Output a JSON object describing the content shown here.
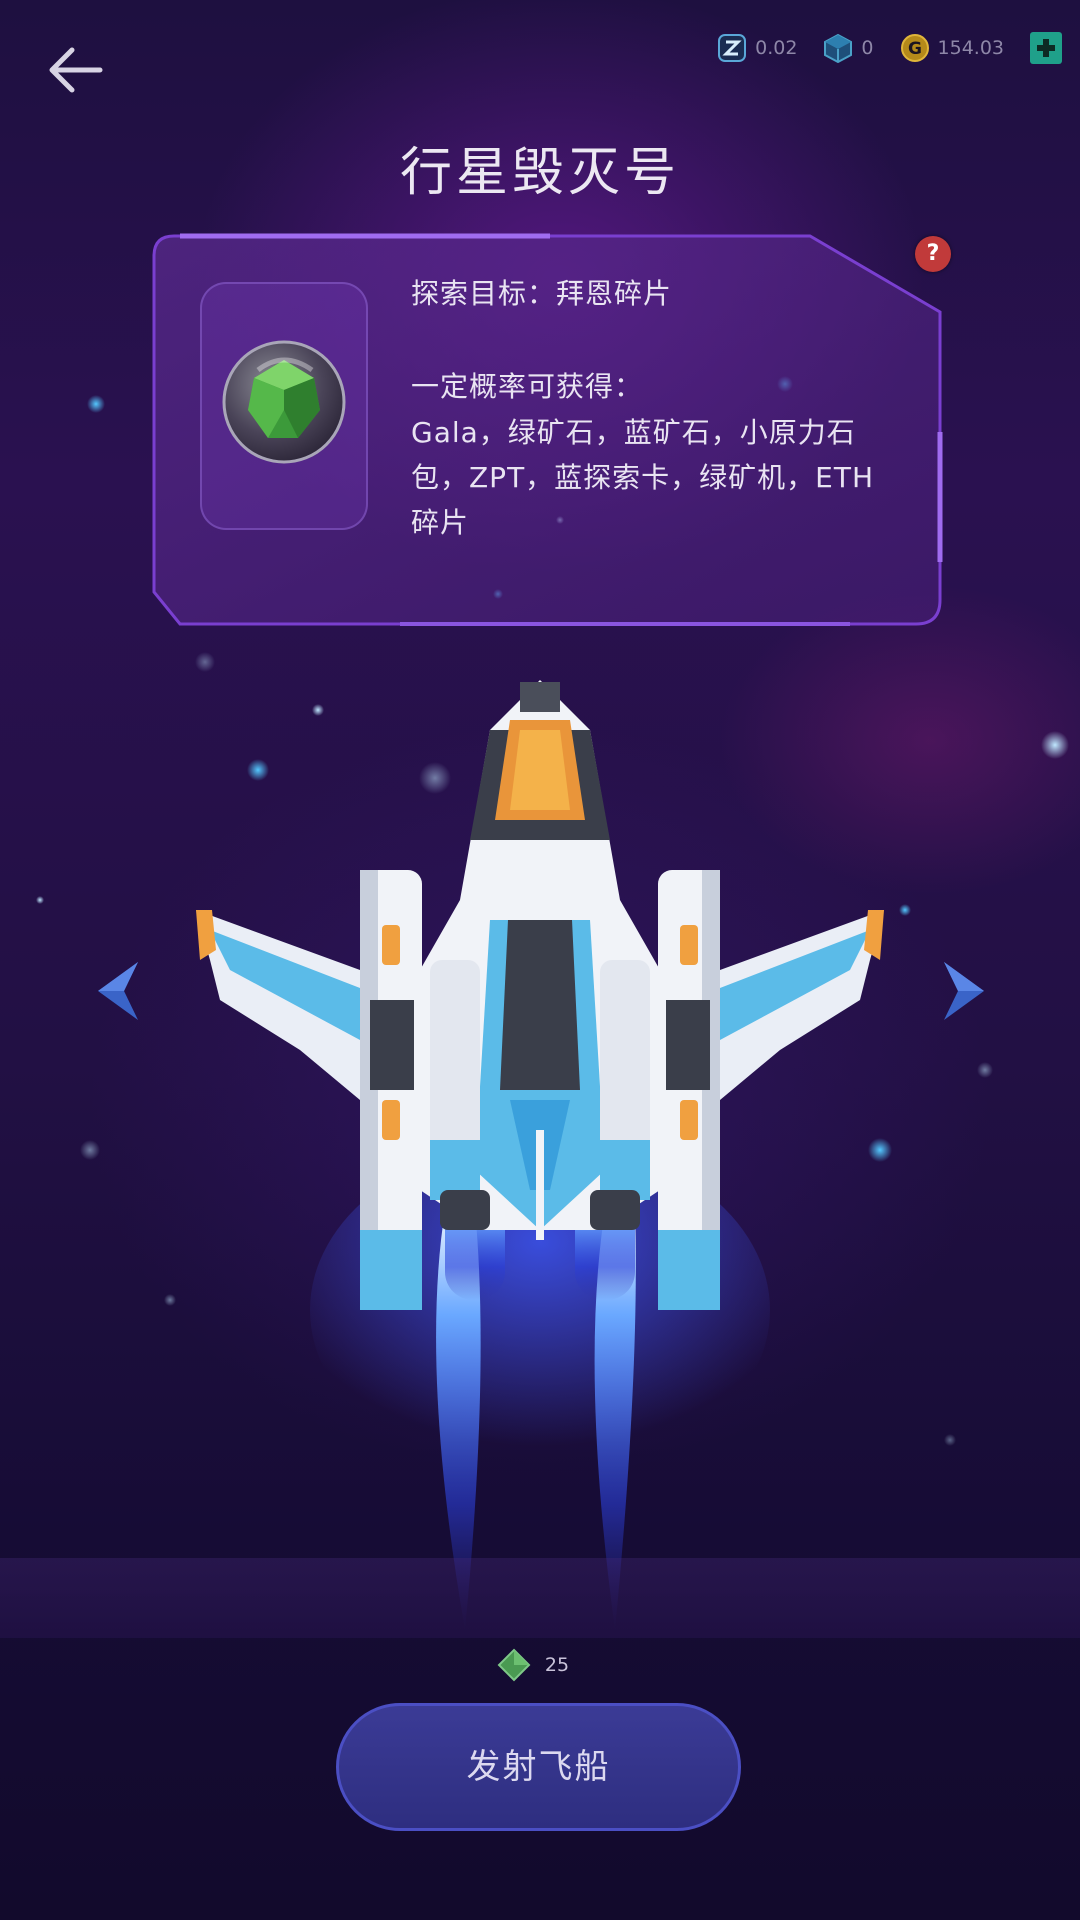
{
  "header": {
    "back_icon": "arrow-left-icon",
    "title": "行星毁灭号"
  },
  "resources": [
    {
      "icon": "zpt-token-icon",
      "value": "0.02"
    },
    {
      "icon": "cube-crystal-icon",
      "value": "0"
    },
    {
      "icon": "gold-coin-icon",
      "value": "154.03"
    }
  ],
  "add_icon": "plus-icon",
  "info": {
    "help_label": "?",
    "target": "探索目标：拜恩碎片",
    "chance_label": "一定概率可获得：",
    "rewards": "Gala，绿矿石，蓝矿石，小原力石包，ZPT，蓝探索卡，绿矿机，ETH碎片",
    "item_icon": "green-gem-orb-icon"
  },
  "ship": {
    "icon": "spaceship-image"
  },
  "nav": {
    "prev_icon": "chevron-left-icon",
    "next_icon": "chevron-right-icon"
  },
  "launch": {
    "cost_icon": "green-diamond-icon",
    "cost": "25",
    "label": "发射飞船"
  },
  "colors": {
    "background": "#1e1040",
    "panel_border": "#7a3fd0",
    "button_fill": "#33338a",
    "button_border": "#4b4fc4",
    "help_red": "#c13a3a",
    "plus_teal": "#1fa08a"
  }
}
